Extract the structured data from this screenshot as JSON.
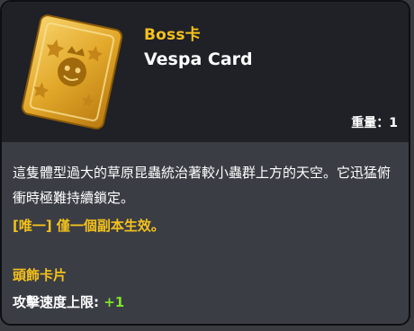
{
  "tooltip": {
    "category": "Boss卡",
    "title": "Vespa Card",
    "weight_label": "重量",
    "weight_sep": "：",
    "weight_value": "1",
    "description": "這隻體型過大的草原昆蟲統治著較小蟲群上方的天空。它迅猛俯衝時極難持續鎖定。",
    "unique_note": "[唯一] 僅一個副本生效。",
    "slot_label": "頭飾卡片",
    "stat_label": "攻擊速度上限: ",
    "stat_value": "+1"
  },
  "icons": {
    "card": "boss-card-icon"
  },
  "colors": {
    "header_bg": "#202127",
    "body_bg": "#3b3d45",
    "accent_gold": "#f4c21b",
    "stat_green": "#7ee32a",
    "text": "#ffffff"
  }
}
